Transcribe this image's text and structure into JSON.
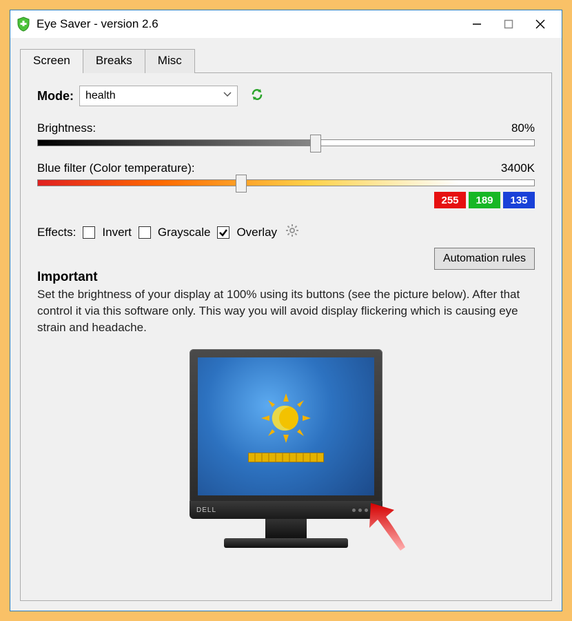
{
  "window": {
    "title": "Eye Saver - version 2.6"
  },
  "tabs": [
    {
      "label": "Screen",
      "active": true
    },
    {
      "label": "Breaks",
      "active": false
    },
    {
      "label": "Misc",
      "active": false
    }
  ],
  "mode": {
    "label": "Mode:",
    "value": "health"
  },
  "brightness": {
    "label": "Brightness:",
    "value_text": "80%",
    "percent": 56
  },
  "bluefilter": {
    "label": "Blue filter (Color temperature):",
    "value_text": "3400K",
    "percent": 41,
    "rgb": {
      "r": "255",
      "g": "189",
      "b": "135"
    }
  },
  "effects": {
    "label": "Effects:",
    "invert": {
      "label": "Invert",
      "checked": false
    },
    "grayscale": {
      "label": "Grayscale",
      "checked": false
    },
    "overlay": {
      "label": "Overlay",
      "checked": true
    }
  },
  "automation_button": "Automation rules",
  "important": {
    "title": "Important",
    "body": "Set the brightness of your display at 100% using its buttons (see the picture below). After that control it via this software only. This way you will avoid display flickering which is causing eye strain and headache."
  },
  "monitor_brand": "DELL"
}
